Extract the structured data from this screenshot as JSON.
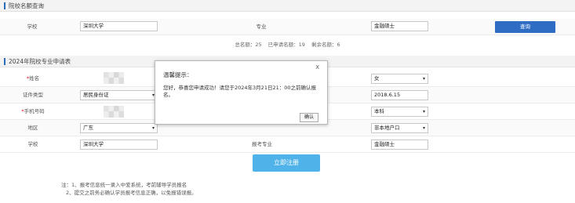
{
  "query_section": {
    "title": "院校名额查询",
    "school_label": "学校",
    "school_value": "深圳大学",
    "major_label": "专业",
    "major_value": "金融硕士",
    "query_button": "查询",
    "stats": {
      "total": "总名额：25",
      "applied": "已申请名额：19",
      "remaining": "剩余名额：6"
    }
  },
  "apply_section": {
    "title": "2024年院校专业申请表",
    "rows": {
      "name_label": "姓名",
      "gender_value": "女",
      "id_type_label": "证件类型",
      "id_type_value": "居民身份证",
      "date_value": "2018.6.15",
      "phone_label": "手机号码",
      "education_value": "本科",
      "region_label": "地区",
      "region_value": "广东",
      "hukou_value": "非本地户口",
      "school_label": "学校",
      "school_value": "深圳大学",
      "major_label": "报考专业",
      "major_value": "金融硕士"
    },
    "required_mark": "*",
    "register_button": "立即注册"
  },
  "notes": [
    "注：1、报考信息统一录入中爱系统，考前辅导学员报名",
    "2、提交之前务必确认学员报考信息正确，以免报错误报。"
  ],
  "modal": {
    "title": "温馨提示：",
    "close_icon": "X",
    "body": "您好，恭喜您申请成功！请您于2024年3月21日21：00之前确认报名。",
    "ok_button": "确认"
  }
}
